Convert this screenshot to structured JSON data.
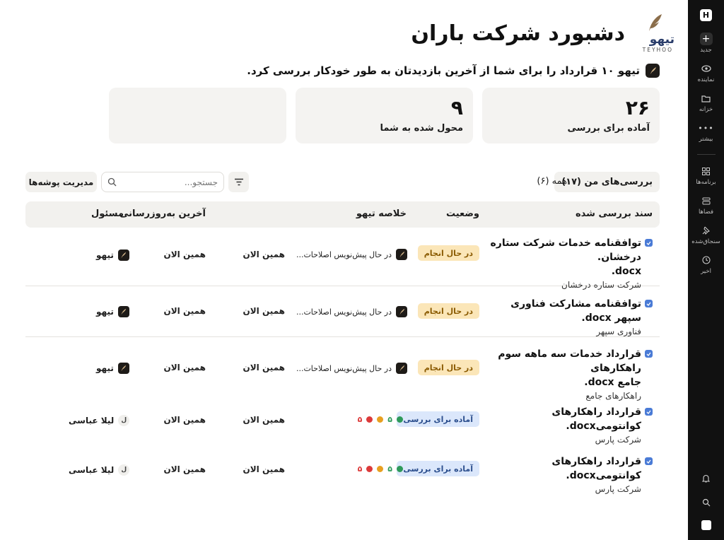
{
  "brand": {
    "name_fa": "تیهو",
    "name_en": "TEYHOO"
  },
  "page": {
    "title": "دشبورد شرکت باران"
  },
  "summary": {
    "text": "تیهو ۱۰ قرارداد را برای شما از آخرین بازدیدتان به طور خودکار بررسی کرد."
  },
  "cards": [
    {
      "number": "۲۶",
      "label": "آماده برای بررسی"
    },
    {
      "number": "۹",
      "label": "محول شده به شما"
    },
    {
      "number": "",
      "label": ""
    }
  ],
  "toolbar": {
    "my_reviews_tab": "بررسی‌های من (۱۷)",
    "all_tab": "همه (۶)",
    "search_placeholder": "جستجو...",
    "manage_folders": "مدیریت پوشه‌ها"
  },
  "table": {
    "headers": {
      "document": "سند بررسی شده",
      "status": "وضعیت",
      "summary": "خلاصه تیهو",
      "updated": "آخرین به‌روزرسانی",
      "owner": "مسئول"
    },
    "rows": [
      {
        "doc_line1": "توافقنامه خدمات شرکت ستاره درخشان.",
        "doc_line2": "docx.",
        "company": "شرکت ستاره درخشان",
        "status": "در حال انجام",
        "summary": "در حال پیش‌نویس اصلاحات...",
        "time1": "همین الان",
        "time2": "همین الان",
        "owner": "تیهو"
      },
      {
        "doc_line1": "توافقنامه مشارکت فناوری سپهر docx.",
        "doc_line2": "",
        "company": "فناوری سپهر",
        "status": "در حال انجام",
        "summary": "در حال پیش‌نویس اصلاحات...",
        "time1": "همین الان",
        "time2": "همین الان",
        "owner": "تیهو"
      },
      {
        "doc_line1": "قرارداد خدمات سه ماهه سوم راهکارهای",
        "doc_line2": "جامع docx.",
        "company": "راهکارهای جامع",
        "status": "در حال انجام",
        "summary": "در حال پیش‌نویس اصلاحات...",
        "time1": "همین الان",
        "time2": "همین الان",
        "owner": "تیهو"
      },
      {
        "doc_line1": "قرارداد راهکارهای کوانتومیdocx.",
        "doc_line2": "",
        "company": "شرکت پارس",
        "status": "آماده برای بررسی",
        "dots": {
          "green": "۵",
          "red": "۵"
        },
        "time1": "همین الان",
        "time2": "همین الان",
        "owner": "لیلا عباسی",
        "owner_initial": "ل"
      },
      {
        "doc_line1": "قرارداد راهکارهای کوانتومیdocx.",
        "doc_line2": "",
        "company": "شرکت پارس",
        "status": "آماده برای بررسی",
        "dots": {
          "green": "۵",
          "red": "۵"
        },
        "time1": "همین الان",
        "time2": "همین الان",
        "owner": "لیلا عباسی",
        "owner_initial": "ل"
      }
    ]
  },
  "rail": {
    "logo": "H",
    "items": [
      "جدید",
      "نماینده",
      "خزانه",
      "بیشتر",
      "برنامه‌ها",
      "فضاها",
      "سنجاق‌شده",
      "اخیر"
    ]
  },
  "colors": {
    "accent_blue": "#4a7bd6",
    "progress_bg": "#fbe6b8",
    "ready_bg": "#dbe7fb",
    "rail_bg": "#111111",
    "dot_green": "#2e9a5a",
    "dot_amber": "#e8a020",
    "dot_red": "#dc3a3a"
  }
}
